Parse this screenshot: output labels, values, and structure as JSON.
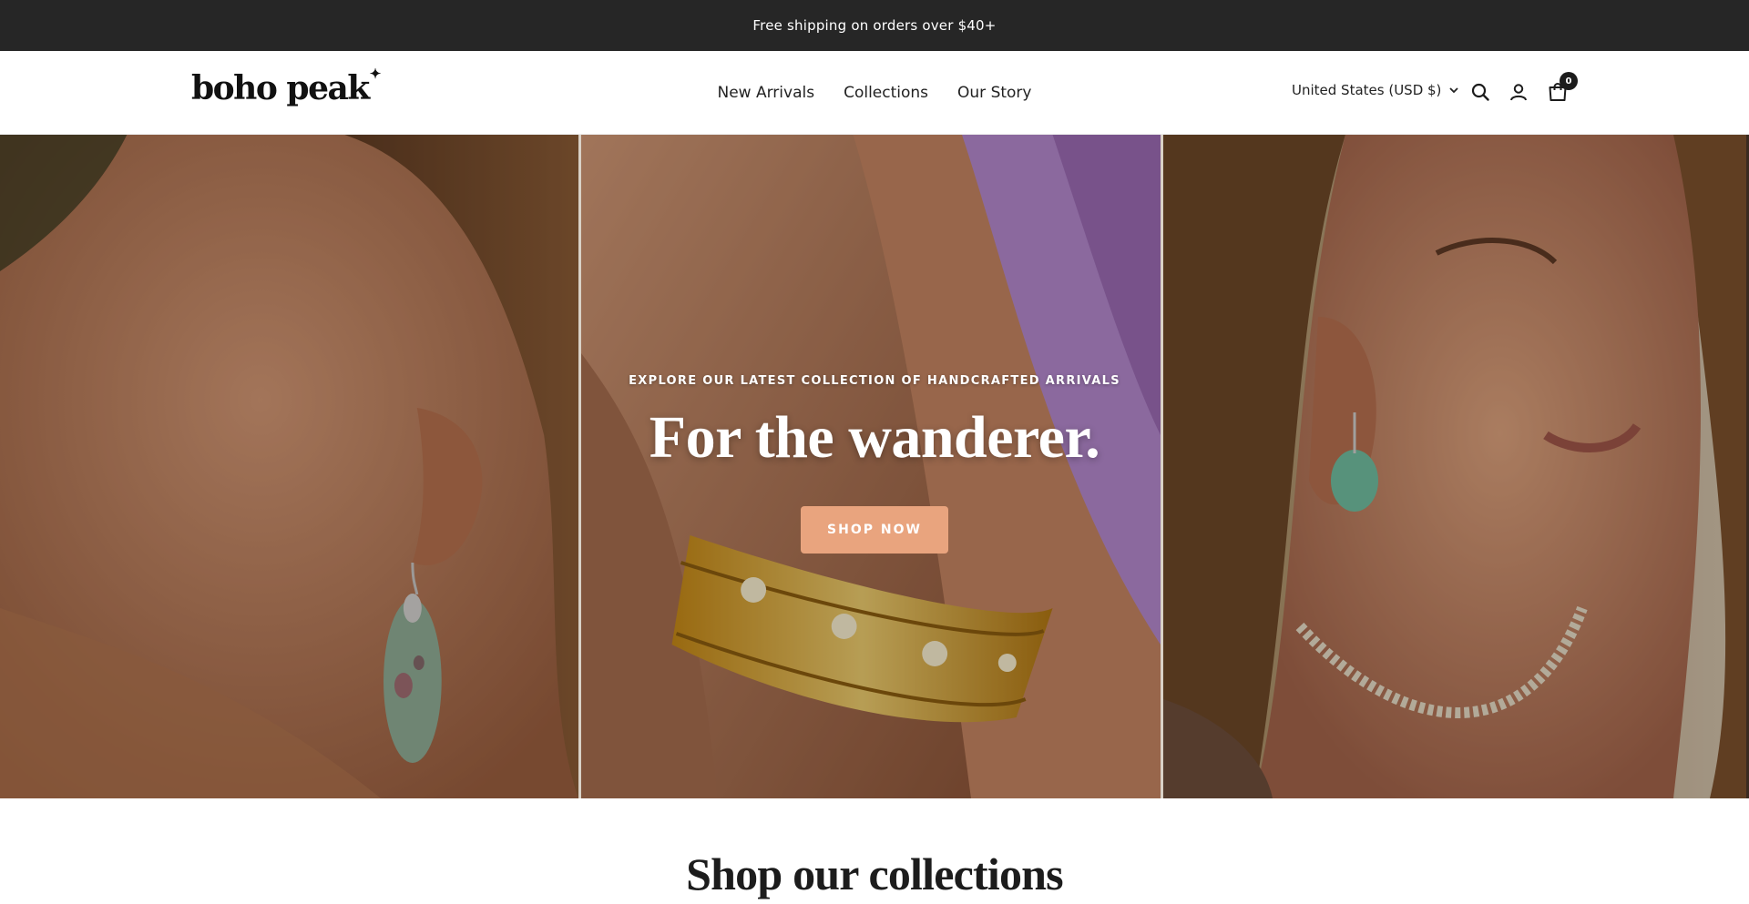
{
  "announcement": {
    "text": "Free shipping on orders over $40+"
  },
  "header": {
    "logo_text": "boho peak",
    "logo_mark": "✦",
    "nav": [
      {
        "label": "New Arrivals"
      },
      {
        "label": "Collections"
      },
      {
        "label": "Our Story"
      }
    ],
    "locale_label": "United States (USD $)",
    "icons": [
      "search-icon",
      "account-icon",
      "cart-icon",
      "chevron-down-icon"
    ],
    "cart_count": "0"
  },
  "hero": {
    "kicker": "EXPLORE OUR LATEST COLLECTION OF HANDCRAFTED ARRIVALS",
    "headline": "For the wanderer.",
    "cta_label": "SHOP NOW",
    "images": [
      "woman-profile-green-earring",
      "hand-gold-star-ring",
      "woman-teal-earring-shell-necklace"
    ]
  },
  "collections": {
    "title": "Shop our collections"
  },
  "colors": {
    "announcement_bg": "#262626",
    "cta_bg": "#e9a47e",
    "text": "#1c1c1c"
  }
}
